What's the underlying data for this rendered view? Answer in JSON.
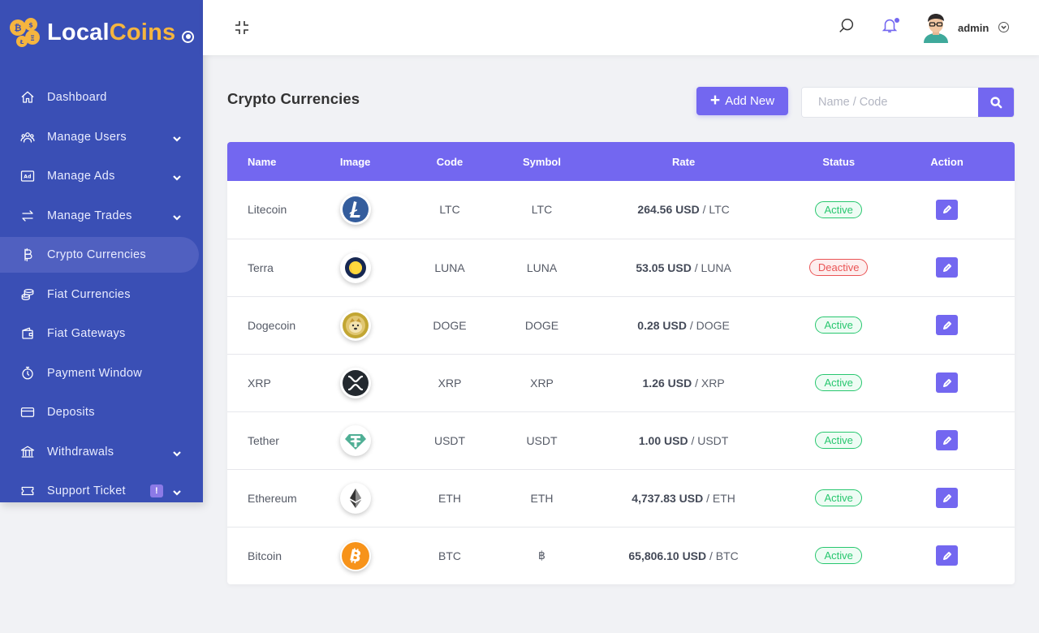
{
  "brand": {
    "name_part1": "Local",
    "name_part2": "Coins"
  },
  "sidebar": {
    "items": [
      {
        "label": "Dashboard",
        "icon": "home-icon",
        "has_chevron": false,
        "active": false
      },
      {
        "label": "Manage Users",
        "icon": "users-icon",
        "has_chevron": true,
        "active": false
      },
      {
        "label": "Manage Ads",
        "icon": "ad-icon",
        "has_chevron": true,
        "active": false
      },
      {
        "label": "Manage Trades",
        "icon": "exchange-icon",
        "has_chevron": true,
        "active": false
      },
      {
        "label": "Crypto Currencies",
        "icon": "bitcoin-icon",
        "has_chevron": false,
        "active": true
      },
      {
        "label": "Fiat Currencies",
        "icon": "coins-icon",
        "has_chevron": false,
        "active": false
      },
      {
        "label": "Fiat Gateways",
        "icon": "wallet-icon",
        "has_chevron": false,
        "active": false
      },
      {
        "label": "Payment Window",
        "icon": "stopwatch-icon",
        "has_chevron": false,
        "active": false
      },
      {
        "label": "Deposits",
        "icon": "credit-card-icon",
        "has_chevron": false,
        "active": false
      },
      {
        "label": "Withdrawals",
        "icon": "bank-icon",
        "has_chevron": true,
        "active": false
      },
      {
        "label": "Support Ticket",
        "icon": "ticket-icon",
        "has_chevron": true,
        "active": false,
        "badge": "!"
      }
    ]
  },
  "header": {
    "user_name": "admin"
  },
  "main": {
    "title": "Crypto Currencies",
    "add_button_label": "Add New",
    "search_placeholder": "Name / Code"
  },
  "table": {
    "columns": [
      "Name",
      "Image",
      "Code",
      "Symbol",
      "Rate",
      "Status",
      "Action"
    ],
    "rows": [
      {
        "name": "Litecoin",
        "image": "litecoin-logo-icon",
        "code": "LTC",
        "symbol": "LTC",
        "rate_value": "264.56 USD",
        "rate_unit": " / LTC",
        "status": "Active"
      },
      {
        "name": "Terra",
        "image": "terra-logo-icon",
        "code": "LUNA",
        "symbol": "LUNA",
        "rate_value": "53.05 USD",
        "rate_unit": " / LUNA",
        "status": "Deactive"
      },
      {
        "name": "Dogecoin",
        "image": "dogecoin-logo-icon",
        "code": "DOGE",
        "symbol": "DOGE",
        "rate_value": "0.28 USD",
        "rate_unit": " / DOGE",
        "status": "Active"
      },
      {
        "name": "XRP",
        "image": "xrp-logo-icon",
        "code": "XRP",
        "symbol": "XRP",
        "rate_value": "1.26 USD",
        "rate_unit": " / XRP",
        "status": "Active"
      },
      {
        "name": "Tether",
        "image": "tether-logo-icon",
        "code": "USDT",
        "symbol": "USDT",
        "rate_value": "1.00 USD",
        "rate_unit": " / USDT",
        "status": "Active"
      },
      {
        "name": "Ethereum",
        "image": "ethereum-logo-icon",
        "code": "ETH",
        "symbol": "ETH",
        "rate_value": "4,737.83 USD",
        "rate_unit": " / ETH",
        "status": "Active"
      },
      {
        "name": "Bitcoin",
        "image": "bitcoin-logo-icon",
        "code": "BTC",
        "symbol": "฿",
        "rate_value": "65,806.10 USD",
        "rate_unit": " / BTC",
        "status": "Active"
      }
    ]
  },
  "colors": {
    "sidebar_bg": "#3a4fb5",
    "accent": "#7367f0",
    "active_status": "#28c76f",
    "deactive_status": "#ea5455",
    "brand_coins": "#f5b53f"
  }
}
